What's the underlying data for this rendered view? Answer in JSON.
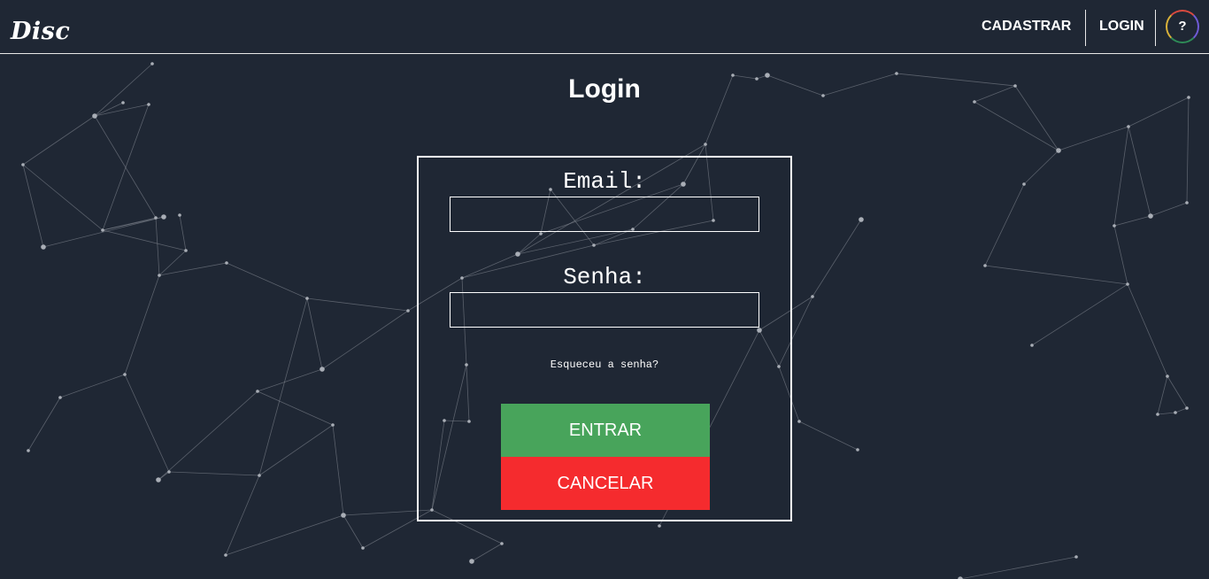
{
  "header": {
    "logo": "Disc",
    "nav": {
      "register": "CADASTRAR",
      "login": "LOGIN",
      "help": "?"
    }
  },
  "main": {
    "title": "Login",
    "form": {
      "email_label": "Email:",
      "email_value": "",
      "password_label": "Senha:",
      "password_value": "",
      "forgot_link": "Esqueceu a senha?",
      "submit_label": "ENTRAR",
      "cancel_label": "CANCELAR"
    }
  },
  "colors": {
    "background": "#1f2734",
    "submit": "#48a45b",
    "cancel": "#f52b2e"
  }
}
